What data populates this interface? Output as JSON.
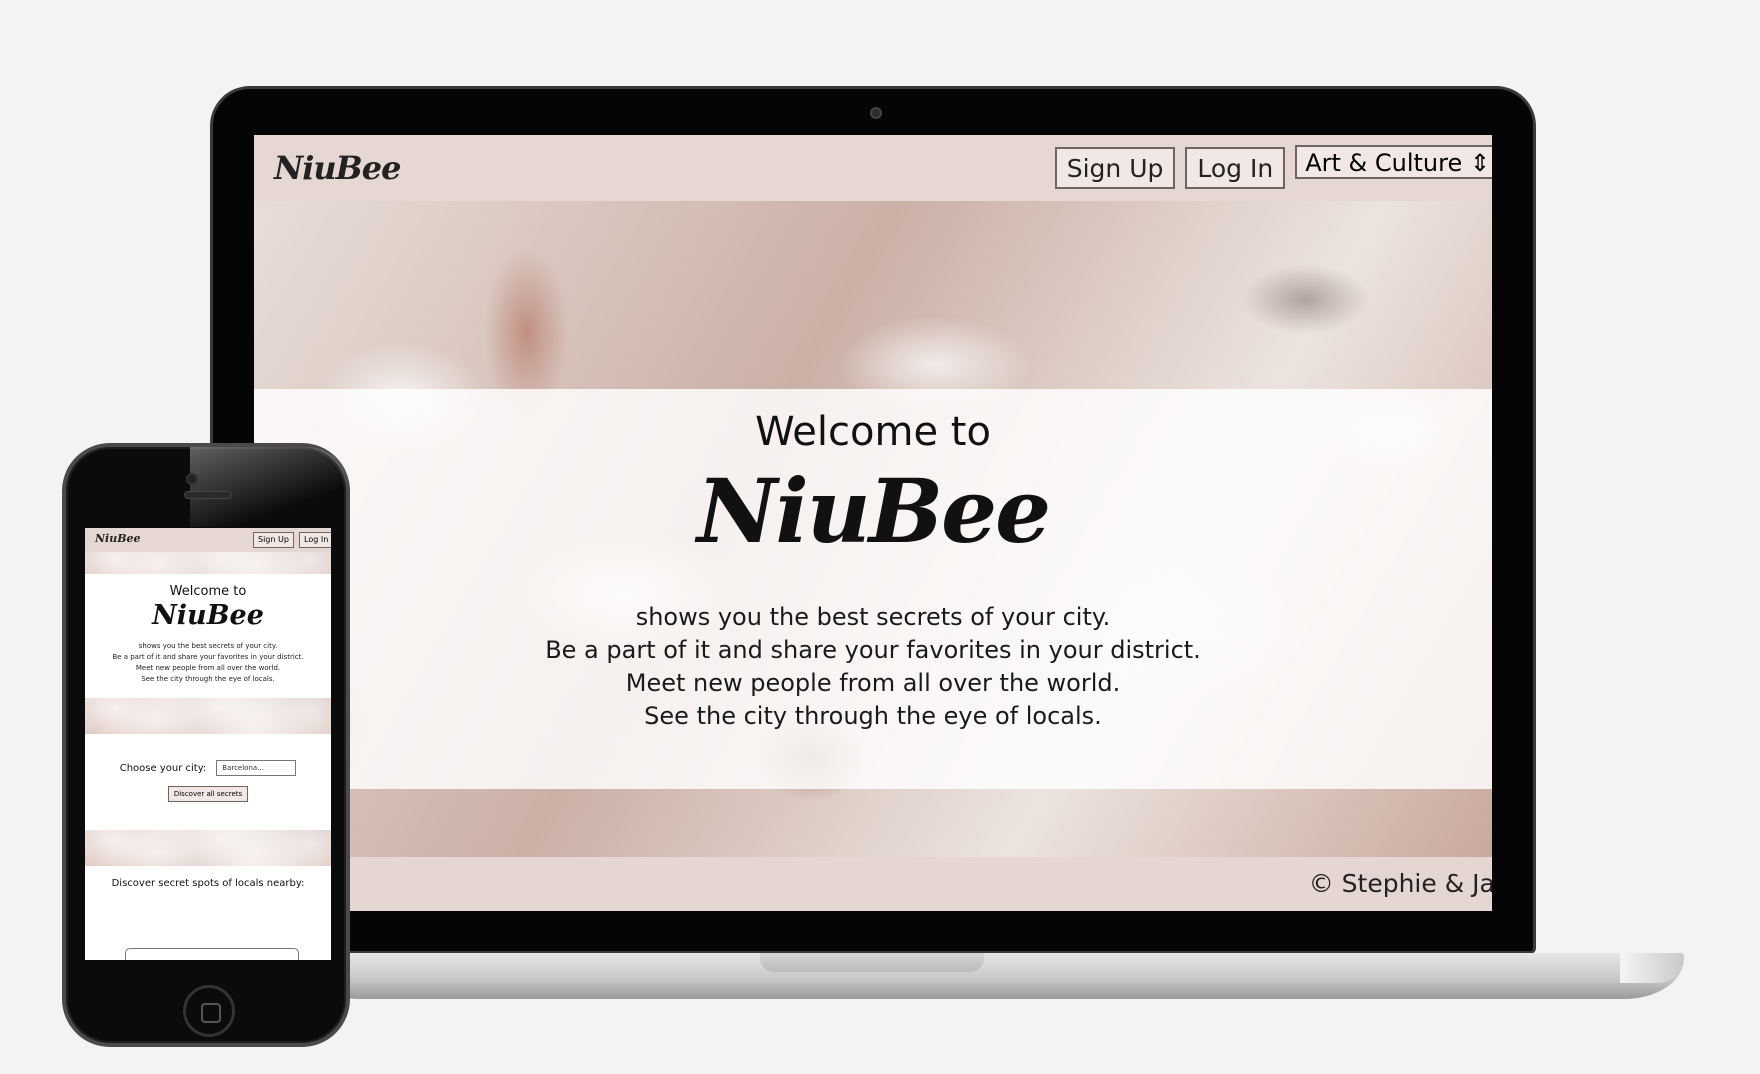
{
  "laptop_site": {
    "logo": "NiuBee",
    "nav": {
      "sign_up": "Sign Up",
      "log_in": "Log In",
      "category_select": "Art & Culture"
    },
    "hero": {
      "welcome": "Welcome to",
      "brand": "NiuBee",
      "lines": [
        "shows you the best secrets of your city.",
        "Be a part of it and share your favorites in your district.",
        "Meet new people from all over the world.",
        "See the city through the eye of locals."
      ]
    },
    "footer": "© Stephie & Jana"
  },
  "phone_site": {
    "logo": "NiuBee",
    "nav": {
      "sign_up": "Sign Up",
      "log_in": "Log In"
    },
    "hero": {
      "welcome": "Welcome to",
      "brand": "NiuBee",
      "lines": [
        "shows you the best secrets of your city.",
        "Be a part of it and share your favorites in your district.",
        "Meet new people from all over the world.",
        "See the city through the eye of locals."
      ]
    },
    "city": {
      "label": "Choose your city:",
      "placeholder": "Barcelona...",
      "button": "Discover all secrets"
    },
    "spots_heading": "Discover secret spots of locals nearby:"
  },
  "colors": {
    "nav_background": "#e7d7d3",
    "device_frame": "#050505",
    "page_background": "#f3f3f3"
  }
}
